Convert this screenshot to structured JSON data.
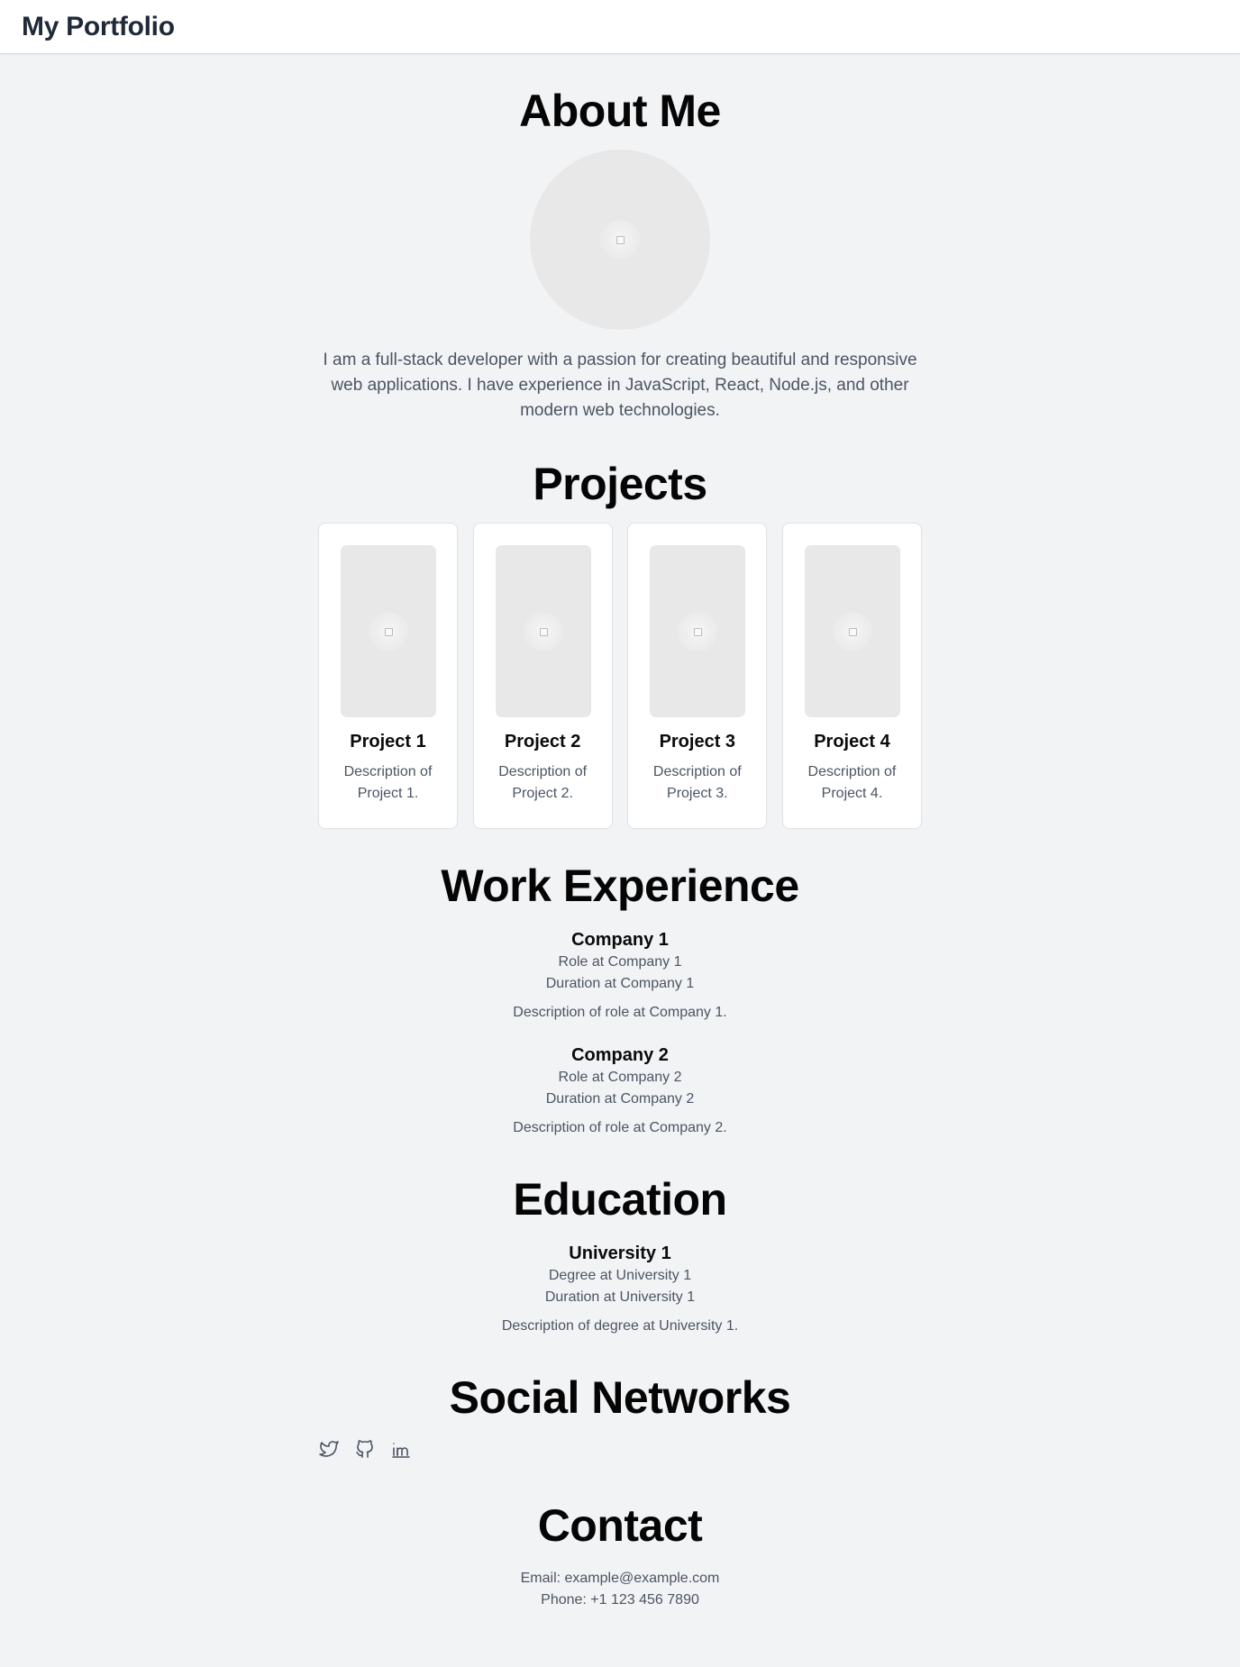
{
  "header": {
    "title": "My Portfolio"
  },
  "about": {
    "heading": "About Me",
    "avatar_icon": "image-placeholder-icon",
    "text": "I am a full-stack developer with a passion for creating beautiful and responsive web applications. I have experience in JavaScript, React, Node.js, and other modern web technologies."
  },
  "projects": {
    "heading": "Projects",
    "items": [
      {
        "name": "Project 1",
        "description": "Description of Project 1."
      },
      {
        "name": "Project 2",
        "description": "Description of Project 2."
      },
      {
        "name": "Project 3",
        "description": "Description of Project 3."
      },
      {
        "name": "Project 4",
        "description": "Description of Project 4."
      }
    ]
  },
  "work": {
    "heading": "Work Experience",
    "items": [
      {
        "company": "Company 1",
        "role": "Role at Company 1",
        "duration": "Duration at Company 1",
        "description": "Description of role at Company 1."
      },
      {
        "company": "Company 2",
        "role": "Role at Company 2",
        "duration": "Duration at Company 2",
        "description": "Description of role at Company 2."
      }
    ]
  },
  "education": {
    "heading": "Education",
    "items": [
      {
        "school": "University 1",
        "degree": "Degree at University 1",
        "duration": "Duration at University 1",
        "description": "Description of degree at University 1."
      }
    ]
  },
  "social": {
    "heading": "Social Networks",
    "links": [
      {
        "icon": "twitter-icon"
      },
      {
        "icon": "github-icon"
      },
      {
        "icon": "linkedin-icon"
      }
    ]
  },
  "contact": {
    "heading": "Contact",
    "email": "Email: example@example.com",
    "phone": "Phone: +1 123 456 7890"
  },
  "colors": {
    "page_background": "#f2f3f5",
    "header_background": "#ffffff",
    "heading_text": "#050505",
    "body_text": "#4b5563",
    "placeholder_fill": "#e8e8e8",
    "icon_stroke": "#4b5563"
  }
}
